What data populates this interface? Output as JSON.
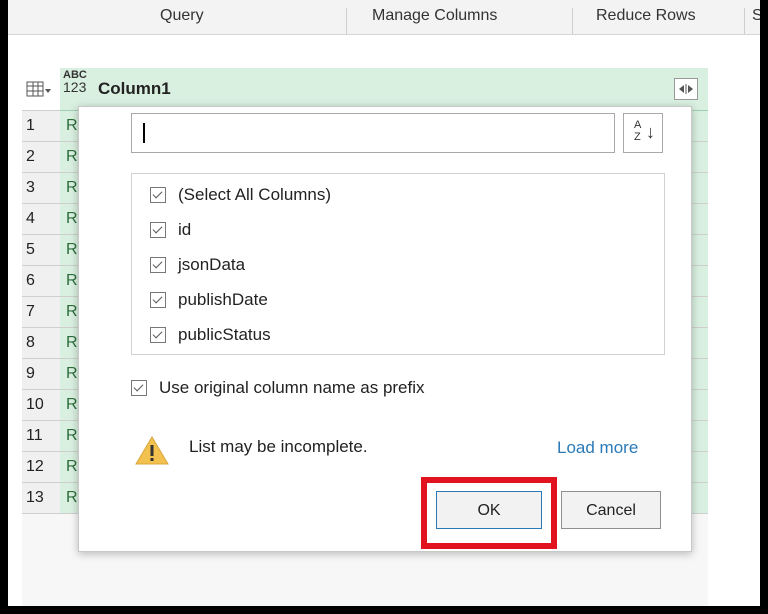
{
  "ribbon": {
    "groups": [
      "Query",
      "Manage Columns",
      "Reduce Rows",
      "S"
    ]
  },
  "column": {
    "type_icon_top": "ABC",
    "type_icon_bottom": "123",
    "name": "Column1",
    "expand_icon": "expand-arrows-icon"
  },
  "rows": [
    {
      "num": "1",
      "value": "R"
    },
    {
      "num": "2",
      "value": "R"
    },
    {
      "num": "3",
      "value": "R"
    },
    {
      "num": "4",
      "value": "R"
    },
    {
      "num": "5",
      "value": "R"
    },
    {
      "num": "6",
      "value": "R"
    },
    {
      "num": "7",
      "value": "R"
    },
    {
      "num": "8",
      "value": "R"
    },
    {
      "num": "9",
      "value": "R"
    },
    {
      "num": "10",
      "value": "R"
    },
    {
      "num": "11",
      "value": "R"
    },
    {
      "num": "12",
      "value": "R"
    },
    {
      "num": "13",
      "value": "Record"
    }
  ],
  "dialog": {
    "search": {
      "value": "",
      "placeholder": ""
    },
    "sort_icon": "sort-az-icon",
    "columns": [
      {
        "label": "(Select All Columns)",
        "checked": true
      },
      {
        "label": "id",
        "checked": true
      },
      {
        "label": "jsonData",
        "checked": true
      },
      {
        "label": "publishDate",
        "checked": true
      },
      {
        "label": "publicStatus",
        "checked": true
      }
    ],
    "prefix_option": {
      "label": "Use original column name as prefix",
      "checked": true
    },
    "warning_text": "List may be incomplete.",
    "load_more": "Load more",
    "ok": "OK",
    "cancel": "Cancel"
  },
  "colors": {
    "column_fill": "#d9efe0",
    "link": "#2a7ab8",
    "highlight": "#e0131f",
    "warning": "#f2c14e"
  }
}
